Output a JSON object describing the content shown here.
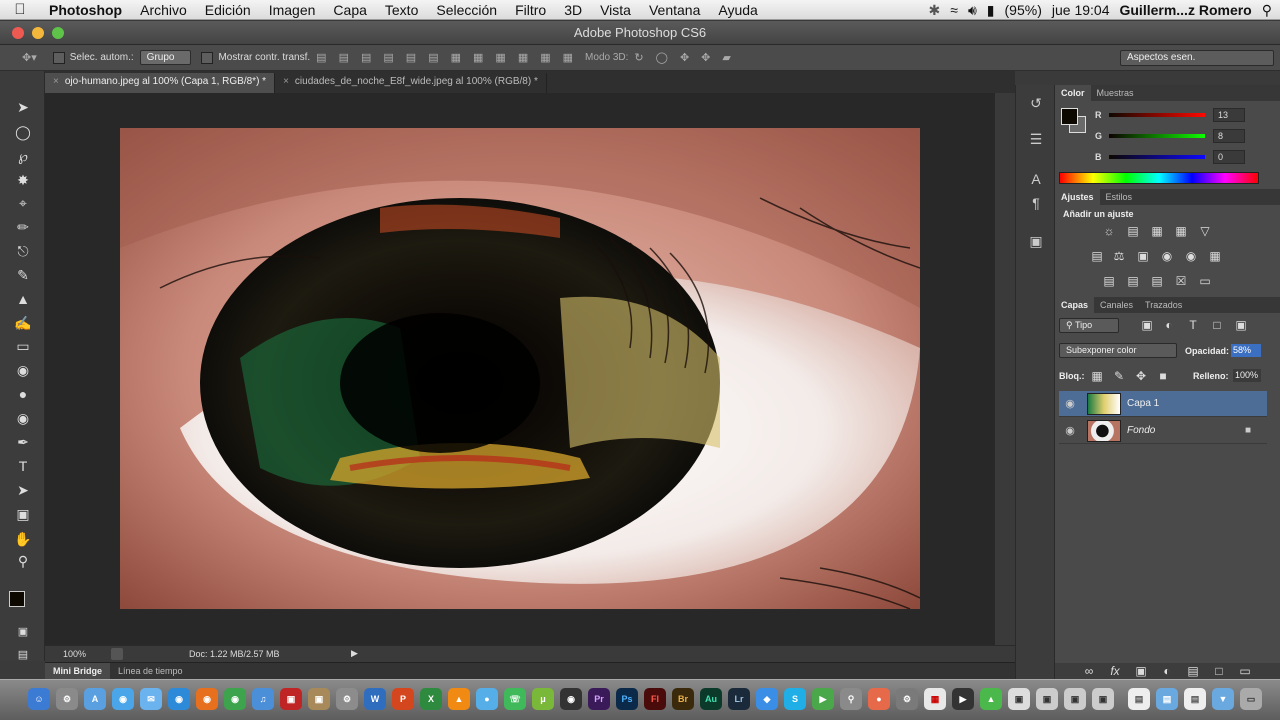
{
  "menubar": {
    "apple_icon": "apple-icon",
    "items": [
      "Photoshop",
      "Archivo",
      "Edición",
      "Imagen",
      "Capa",
      "Texto",
      "Selección",
      "Filtro",
      "3D",
      "Vista",
      "Ventana",
      "Ayuda"
    ],
    "battery": "(95%)",
    "clock": "jue 19:04",
    "user": "Guillerm...z Romero"
  },
  "window": {
    "title": "Adobe Photoshop CS6"
  },
  "options": {
    "auto_select_label": "Selec. autom.:",
    "auto_select_value": "Grupo",
    "show_transform_label": "Mostrar contr. transf.",
    "mode3d_label": "Modo 3D:",
    "workspace": "Aspectos esen."
  },
  "tabs": [
    {
      "label": "ojo-humano.jpeg al 100% (Capa 1, RGB/8*) *",
      "active": true
    },
    {
      "label": "ciudades_de_noche_E8f_wide.jpeg al 100% (RGB/8) *",
      "active": false
    }
  ],
  "status": {
    "zoom": "100%",
    "doc": "Doc: 1.22 MB/2.57 MB"
  },
  "bottom_tabs": {
    "mini_bridge": "Mini Bridge",
    "timeline": "Línea de tiempo"
  },
  "color_panel": {
    "tabs": [
      "Color",
      "Muestras"
    ],
    "r": "13",
    "g": "8",
    "b": "0",
    "r_label": "R",
    "g_label": "G",
    "b_label": "B"
  },
  "adjust_panel": {
    "tabs": [
      "Ajustes",
      "Estilos"
    ],
    "heading": "Añadir un ajuste"
  },
  "layers_panel": {
    "tabs": [
      "Capas",
      "Canales",
      "Trazados"
    ],
    "filter": "Tipo",
    "blend_mode": "Subexponer color",
    "opacity_label": "Opacidad:",
    "opacity_value": "58%",
    "lock_label": "Bloq.:",
    "fill_label": "Relleno:",
    "fill_value": "100%",
    "layers": [
      "Capa 1",
      "Fondo"
    ]
  },
  "colors": {
    "accent": "#4d6d96",
    "chrome": "#3a3a3a",
    "panel": "#4a4a4a"
  }
}
